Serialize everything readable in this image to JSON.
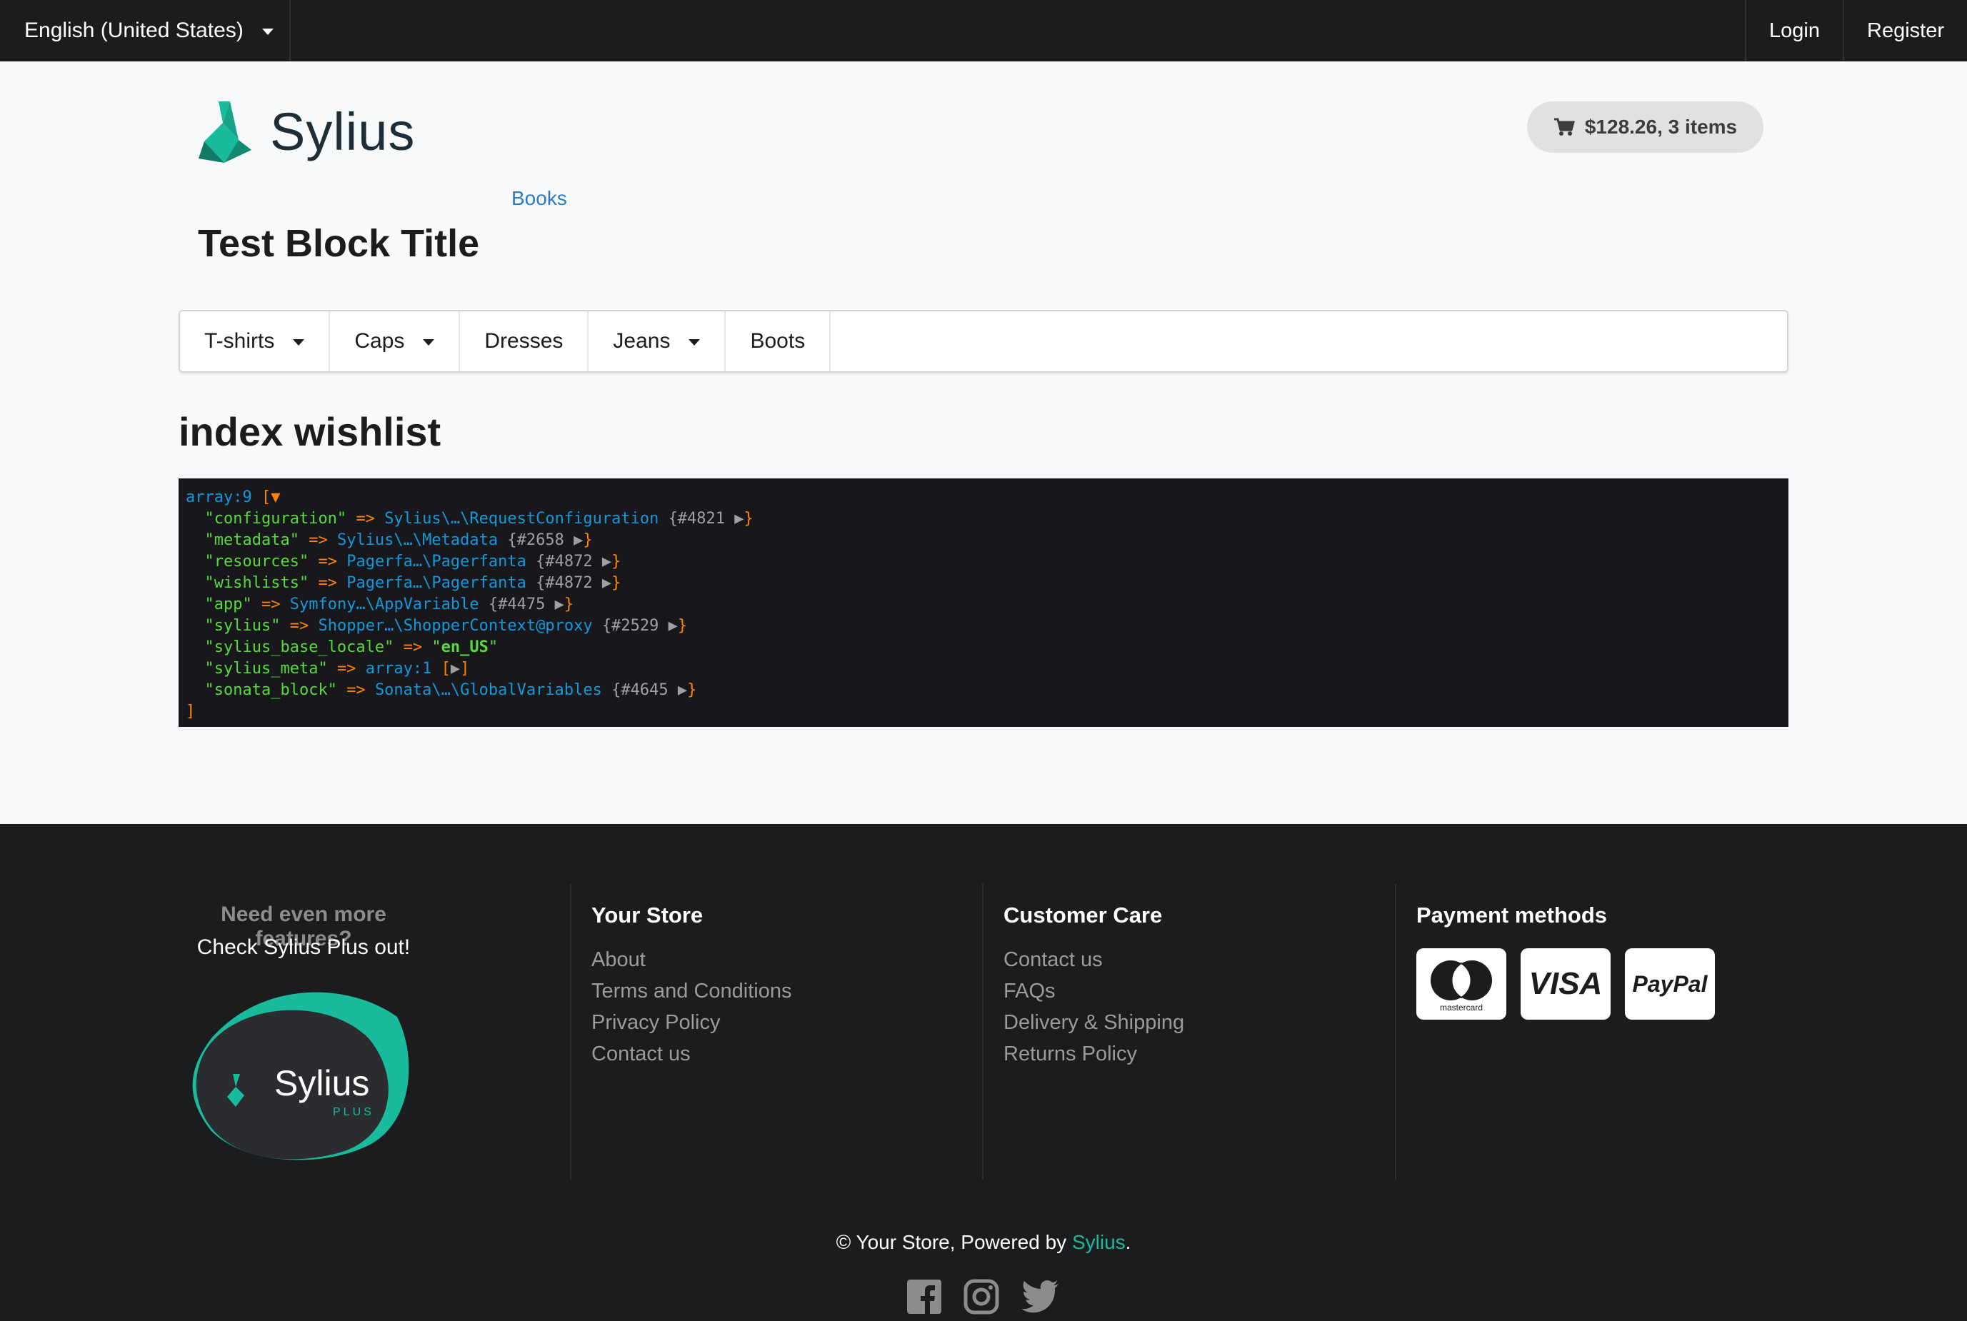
{
  "topbar": {
    "language": "English (United States)",
    "login": "Login",
    "register": "Register"
  },
  "header": {
    "logo_text": "Sylius",
    "cart_summary": "$128.26, 3 items",
    "books_link": "Books",
    "block_title": "Test Block Title"
  },
  "menu": {
    "items": [
      {
        "label": "T-shirts",
        "dropdown": true
      },
      {
        "label": "Caps",
        "dropdown": true
      },
      {
        "label": "Dresses",
        "dropdown": false
      },
      {
        "label": "Jeans",
        "dropdown": true
      },
      {
        "label": "Boots",
        "dropdown": false
      }
    ]
  },
  "page": {
    "heading": "index wishlist"
  },
  "dump": {
    "header": "array:9",
    "entries": [
      {
        "key": "\"configuration\"",
        "ns": "Sylius\\…\\",
        "cls": "RequestConfiguration",
        "ref": "{#4821"
      },
      {
        "key": "\"metadata\"",
        "ns": "Sylius\\…\\",
        "cls": "Metadata",
        "ref": "{#2658"
      },
      {
        "key": "\"resources\"",
        "ns": "Pagerfa…\\",
        "cls": "Pagerfanta",
        "ref": "{#4872"
      },
      {
        "key": "\"wishlists\"",
        "ns": "Pagerfa…\\",
        "cls": "Pagerfanta",
        "ref": "{#4872"
      },
      {
        "key": "\"app\"",
        "ns": "Symfony…\\",
        "cls": "AppVariable",
        "ref": "{#4475"
      },
      {
        "key": "\"sylius\"",
        "ns": "Shopper…\\",
        "cls": "ShopperContext@proxy",
        "ref": "{#2529"
      },
      {
        "key": "\"sylius_base_locale\"",
        "value": "en_US"
      },
      {
        "key": "\"sylius_meta\"",
        "array": "array:1"
      },
      {
        "key": "\"sonata_block\"",
        "ns": "Sonata\\…\\",
        "cls": "GlobalVariables",
        "ref": "{#4645"
      }
    ],
    "close": "]"
  },
  "footer": {
    "promo_heading": "Need even more features?",
    "promo_text": "Check Sylius Plus out!",
    "plus_logo_text": "Sylius",
    "plus_logo_sub": "PLUS",
    "your_store": {
      "heading": "Your Store",
      "links": [
        "About",
        "Terms and Conditions",
        "Privacy Policy",
        "Contact us"
      ]
    },
    "customer_care": {
      "heading": "Customer Care",
      "links": [
        "Contact us",
        "FAQs",
        "Delivery & Shipping",
        "Returns Policy"
      ]
    },
    "payment": {
      "heading": "Payment methods",
      "methods": [
        "mastercard",
        "VISA",
        "PayPal"
      ]
    },
    "copyright_prefix": "© Your Store, Powered by ",
    "copyright_link": "Sylius",
    "copyright_suffix": "."
  },
  "colors": {
    "topbar_bg": "#1b1c1d",
    "accent": "#1abb9c",
    "link": "#2c7bbf",
    "dump_bg": "#18171b"
  }
}
